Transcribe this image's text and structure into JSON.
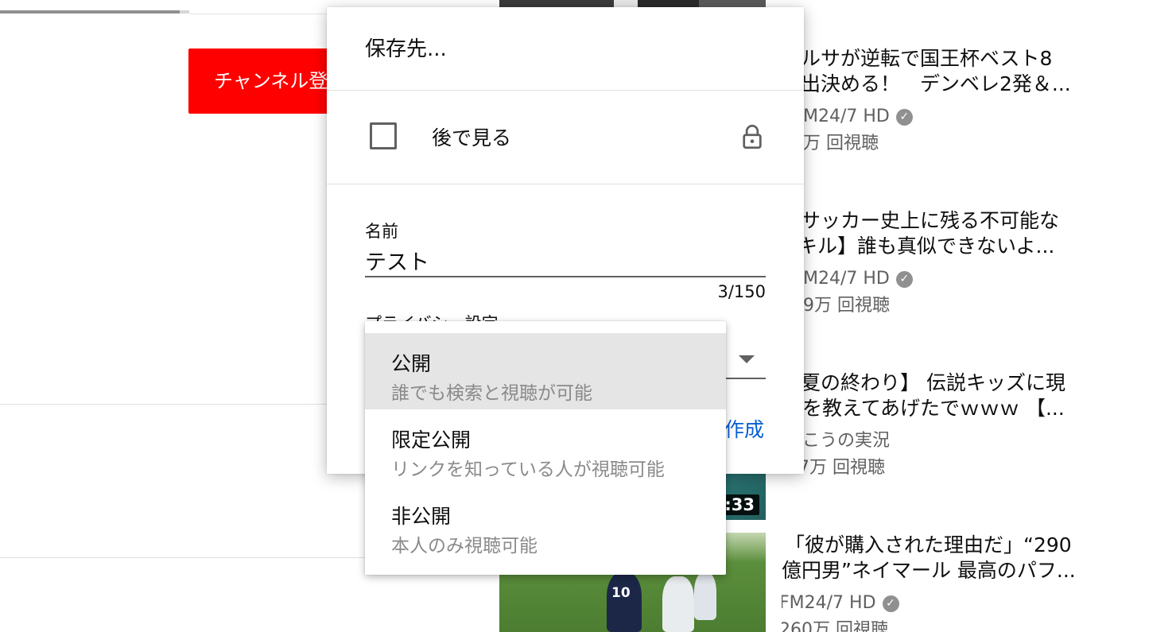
{
  "background": {
    "progress_fraction": 0.95,
    "subscribe_label": "チャンネル登録"
  },
  "related_videos": [
    {
      "title_line1": "ルサが逆転で国王杯ベスト8",
      "title_line2": "出決める！　デンベレ2発＆...",
      "channel": "M24/7 HD",
      "views": "万 回視聴"
    },
    {
      "title_line1": "サッカー史上に残る不可能な",
      "title_line2": "キル】誰も真似できないよ...",
      "channel": "M24/7 HD",
      "views": "9万 回視聴"
    },
    {
      "title_line1": "夏の終わり】 伝説キッズに現",
      "title_line2": "を教えてあげたでｗｗｗ 【...",
      "channel": "こうの実況",
      "views": "2.7万 回視聴",
      "duration": ":33"
    },
    {
      "title_line1": "「彼が購入された理由だ」“290",
      "title_line2": "億円男”ネイマール 最高のパフ...",
      "channel": "FM24/7 HD",
      "views": "260万 回視聴",
      "jersey_number": "10"
    }
  ],
  "dialog": {
    "title": "保存先...",
    "watch_later_label": "後で見る",
    "name_label": "名前",
    "name_value": "テスト",
    "char_count": "3/150",
    "privacy_label": "プライバシー設定",
    "create_label": "作成"
  },
  "privacy_menu": {
    "options": [
      {
        "title": "公開",
        "desc": "誰でも検索と視聴が可能",
        "selected": true
      },
      {
        "title": "限定公開",
        "desc": "リンクを知っている人が視聴可能",
        "selected": false
      },
      {
        "title": "非公開",
        "desc": "本人のみ視聴可能",
        "selected": false
      }
    ]
  },
  "icons": {
    "checkbox": "checkbox-unchecked-icon",
    "lock": "lock-icon",
    "caret": "dropdown-caret-icon",
    "verified": "verified-check-icon"
  }
}
